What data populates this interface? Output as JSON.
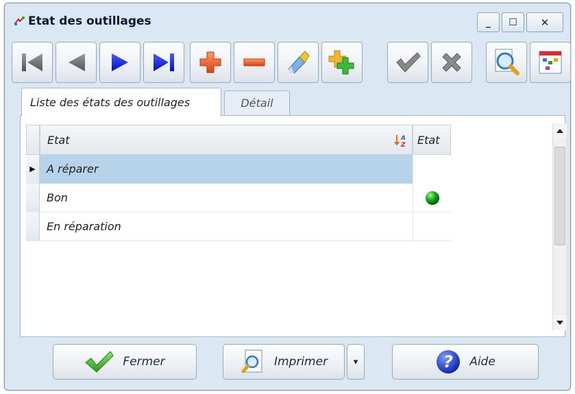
{
  "window": {
    "title": "Etat des outillages",
    "minimize_symbol": "_",
    "maximize_symbol": "☐",
    "close_symbol": "✕"
  },
  "toolbar": {
    "buttons": [
      {
        "icon": "first-record-icon"
      },
      {
        "icon": "previous-record-icon"
      },
      {
        "icon": "next-record-icon"
      },
      {
        "icon": "last-record-icon"
      },
      {
        "icon": "add-icon"
      },
      {
        "icon": "delete-icon"
      },
      {
        "icon": "edit-brush-icon"
      },
      {
        "icon": "duplicate-icon"
      },
      {
        "icon": "validate-icon"
      },
      {
        "icon": "cancel-icon"
      },
      {
        "icon": "search-icon"
      },
      {
        "icon": "grid-settings-icon"
      }
    ]
  },
  "tabs": {
    "list_label": "Liste des états des outillages",
    "detail_label": "Détail"
  },
  "grid": {
    "columns": [
      "Etat",
      "Etat"
    ],
    "sort_indicator": "A Z",
    "rows": [
      {
        "label": "A réparer",
        "status": "",
        "selected": true
      },
      {
        "label": "Bon",
        "status": "green",
        "selected": false
      },
      {
        "label": "En réparation",
        "status": "",
        "selected": false
      }
    ],
    "current_row_marker": "▶",
    "selected_row_color": "#b6d3ea",
    "status_green_color": "#1fa81f"
  },
  "buttons": {
    "close_label": "Fermer",
    "print_label": "Imprimer",
    "help_label": "Aide",
    "print_dropdown_symbol": "▾"
  }
}
